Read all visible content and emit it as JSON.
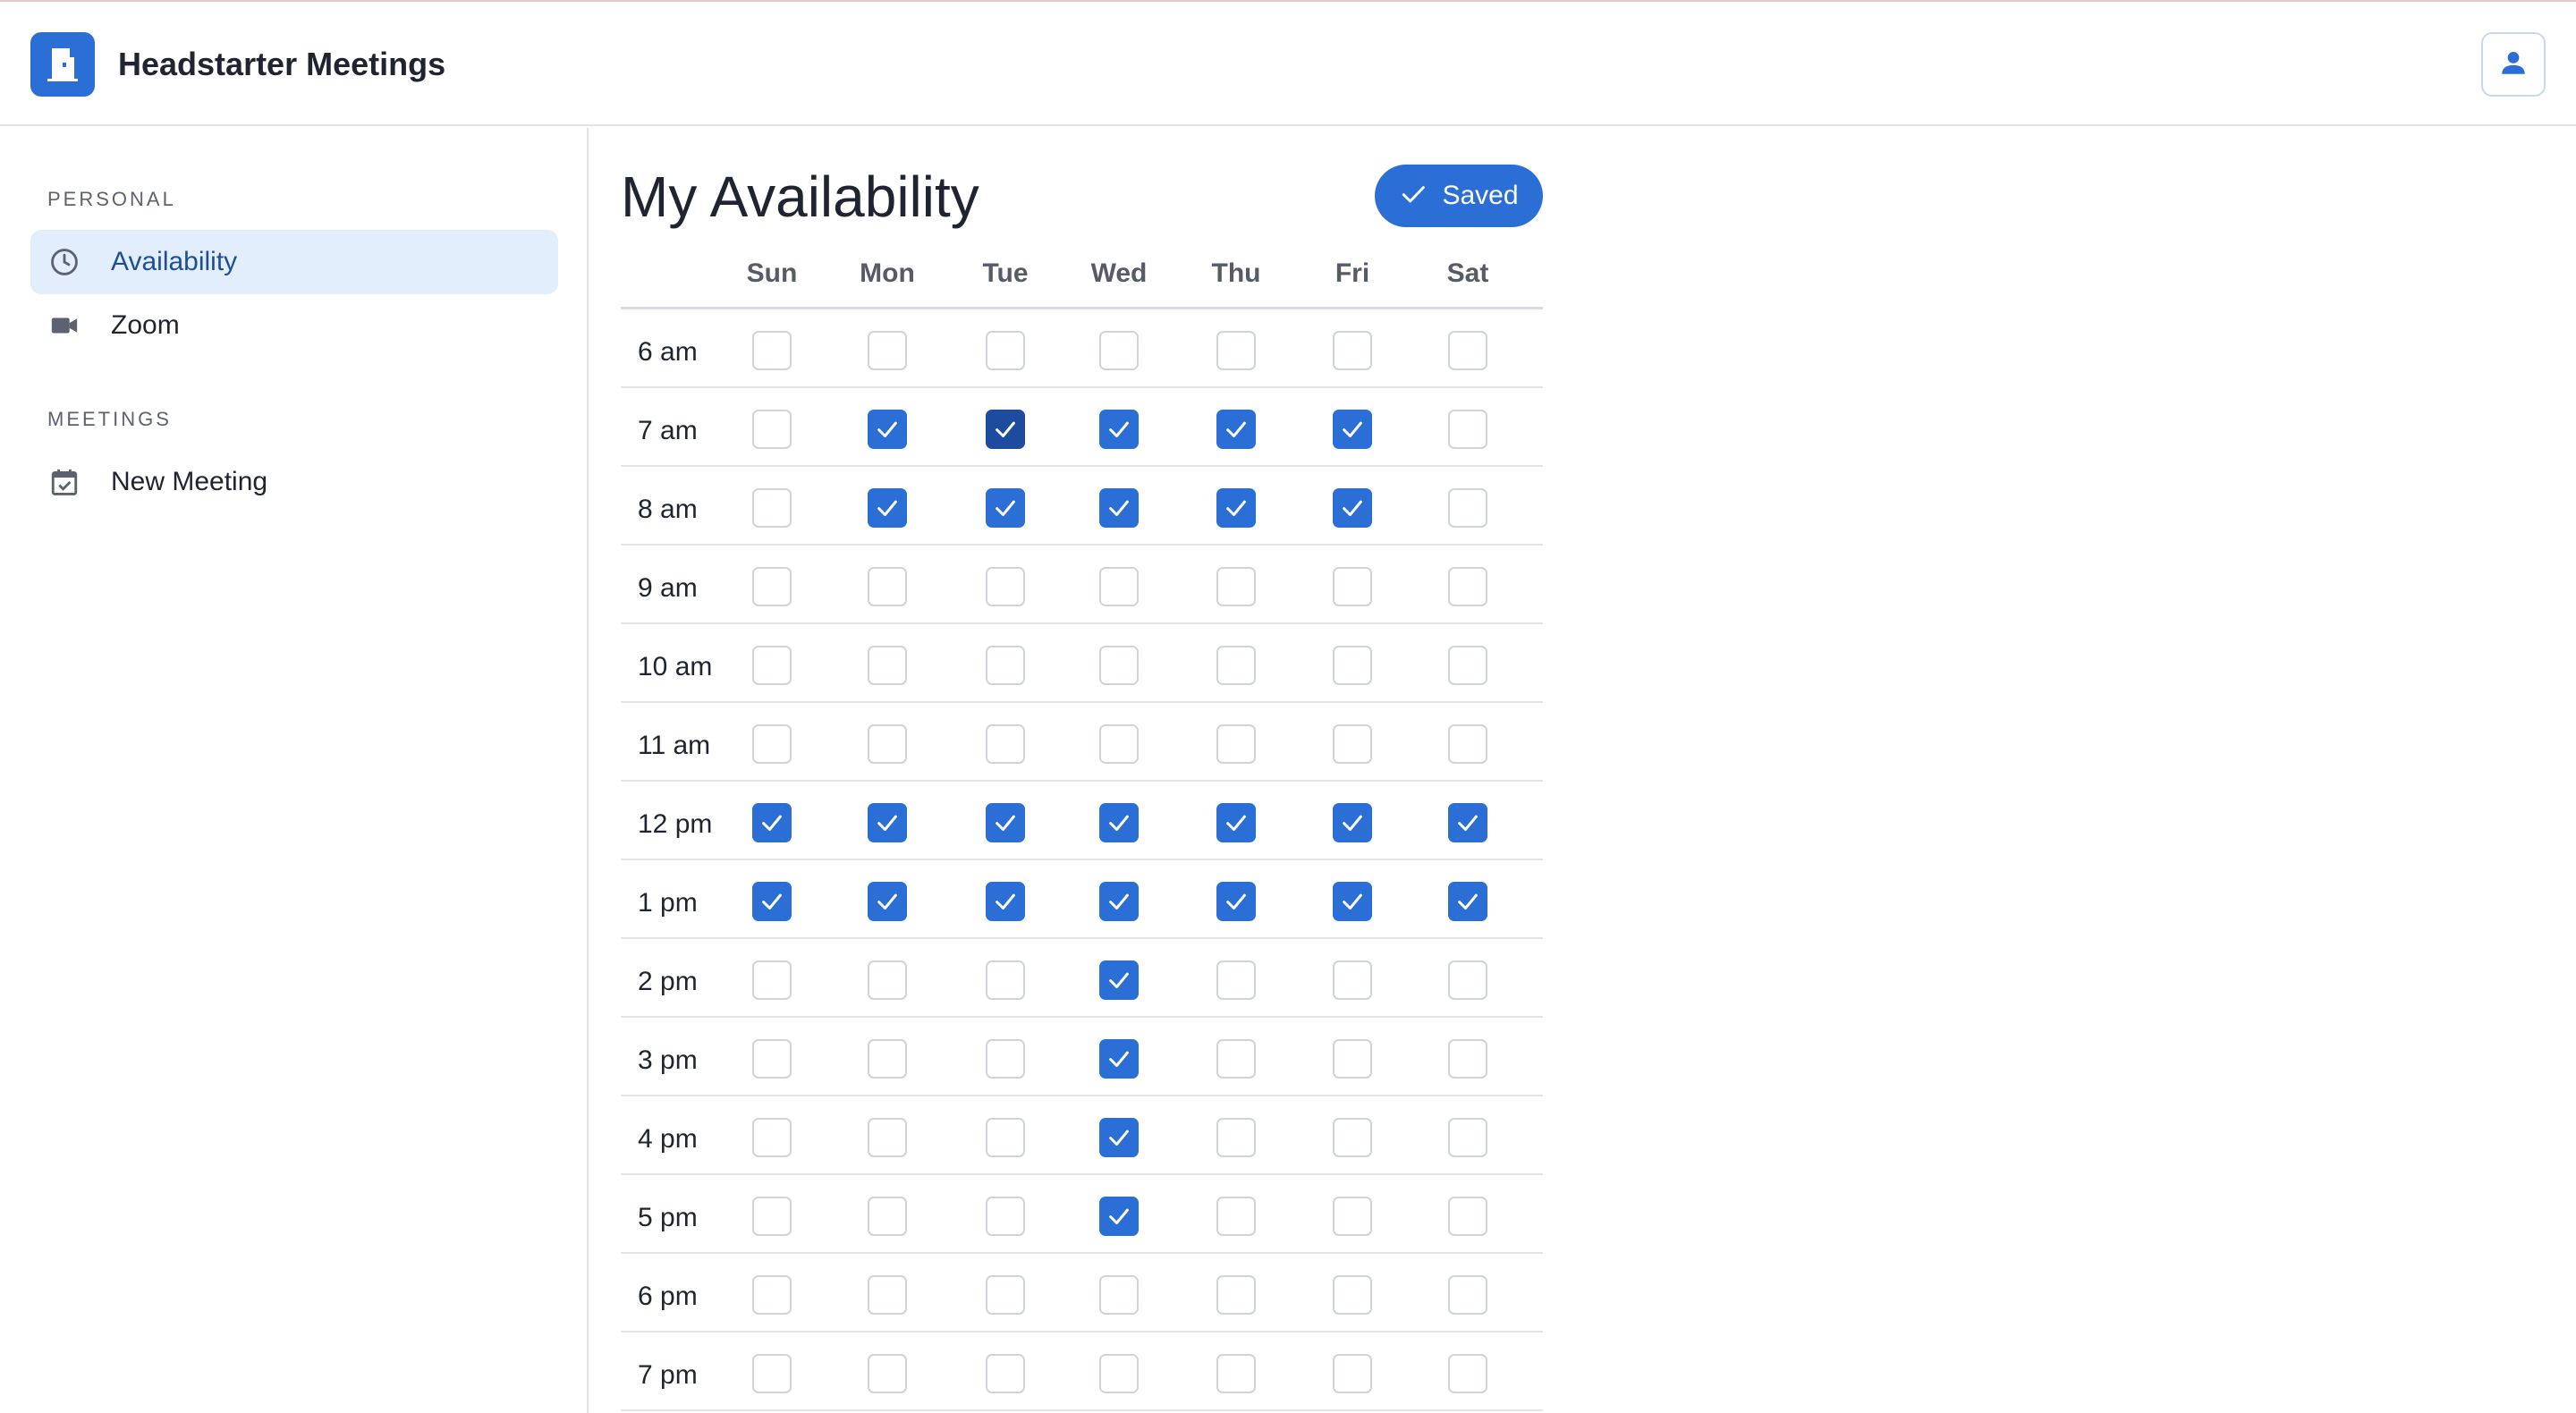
{
  "app": {
    "title": "Headstarter Meetings",
    "logo_icon": "door-icon",
    "user_icon": "user-icon"
  },
  "colors": {
    "accent": "#2b6fd6",
    "accent_focused": "#1d4c9e",
    "active_nav_bg": "#e2eefb",
    "active_nav_text": "#1e4f94"
  },
  "sidebar": {
    "personal_label": "PERSONAL",
    "meetings_label": "MEETINGS",
    "items": [
      {
        "label": "Availability",
        "icon": "clock-icon",
        "active": true
      },
      {
        "label": "Zoom",
        "icon": "video-camera-icon",
        "active": false
      },
      {
        "label": "New Meeting",
        "icon": "calendar-check-icon",
        "active": false
      }
    ]
  },
  "main": {
    "title": "My Availability",
    "saved_label": "Saved",
    "saved_icon": "check-icon"
  },
  "availability": {
    "days": [
      "Sun",
      "Mon",
      "Tue",
      "Wed",
      "Thu",
      "Fri",
      "Sat"
    ],
    "rows": [
      {
        "time": "6 am",
        "checked": [
          0,
          0,
          0,
          0,
          0,
          0,
          0
        ]
      },
      {
        "time": "7 am",
        "checked": [
          0,
          1,
          1,
          1,
          1,
          1,
          0
        ]
      },
      {
        "time": "8 am",
        "checked": [
          0,
          1,
          1,
          1,
          1,
          1,
          0
        ]
      },
      {
        "time": "9 am",
        "checked": [
          0,
          0,
          0,
          0,
          0,
          0,
          0
        ]
      },
      {
        "time": "10 am",
        "checked": [
          0,
          0,
          0,
          0,
          0,
          0,
          0
        ]
      },
      {
        "time": "11 am",
        "checked": [
          0,
          0,
          0,
          0,
          0,
          0,
          0
        ]
      },
      {
        "time": "12 pm",
        "checked": [
          1,
          1,
          1,
          1,
          1,
          1,
          1
        ]
      },
      {
        "time": "1 pm",
        "checked": [
          1,
          1,
          1,
          1,
          1,
          1,
          1
        ]
      },
      {
        "time": "2 pm",
        "checked": [
          0,
          0,
          0,
          1,
          0,
          0,
          0
        ]
      },
      {
        "time": "3 pm",
        "checked": [
          0,
          0,
          0,
          1,
          0,
          0,
          0
        ]
      },
      {
        "time": "4 pm",
        "checked": [
          0,
          0,
          0,
          1,
          0,
          0,
          0
        ]
      },
      {
        "time": "5 pm",
        "checked": [
          0,
          0,
          0,
          1,
          0,
          0,
          0
        ]
      },
      {
        "time": "6 pm",
        "checked": [
          0,
          0,
          0,
          0,
          0,
          0,
          0
        ]
      },
      {
        "time": "7 pm",
        "checked": [
          0,
          0,
          0,
          0,
          0,
          0,
          0
        ]
      }
    ],
    "focused_cell": {
      "time": "7 am",
      "day": "Tue"
    }
  }
}
